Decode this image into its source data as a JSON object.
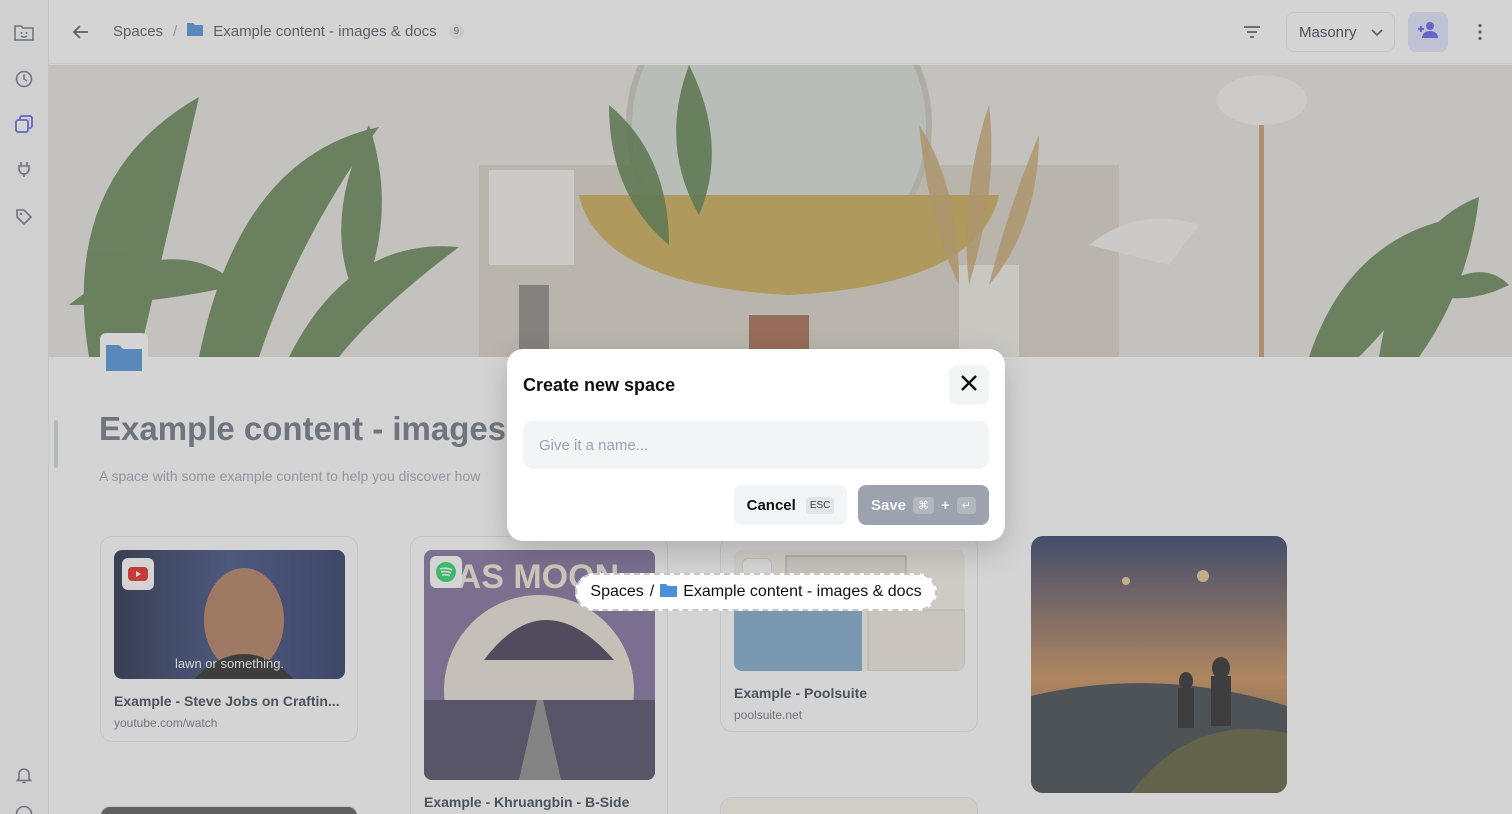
{
  "breadcrumb": {
    "root": "Spaces",
    "separator": "/",
    "space": "Example content - images & docs",
    "count": "9"
  },
  "toolbar": {
    "view_mode": "Masonry"
  },
  "space": {
    "title": "Example content - images & docs",
    "description": "A space with some example content to help you discover how"
  },
  "cards": [
    {
      "title": "Example - Steve Jobs on Craftin...",
      "url": "youtube.com/watch",
      "caption": "lawn or something.",
      "source_icon": "youtube-icon"
    },
    {
      "title": "Example - Khruangbin - B-Side",
      "url": "",
      "caption": "",
      "source_icon": "spotify-icon"
    },
    {
      "title": "Example - Poolsuite",
      "url": "poolsuite.net",
      "caption": "",
      "source_icon": "app-icon"
    },
    {
      "title": "",
      "url": "",
      "caption": "",
      "source_icon": ""
    }
  ],
  "modal": {
    "title": "Create new space",
    "placeholder": "Give it a name...",
    "cancel_label": "Cancel",
    "cancel_key": "ESC",
    "save_label": "Save",
    "save_key_cmd": "⌘",
    "save_key_plus": "+",
    "save_key_enter": "↵"
  },
  "drag_chip": {
    "root": "Spaces",
    "separator": "/",
    "space": "Example content - images & docs"
  },
  "colors": {
    "accent": "#5b5fef",
    "overlay": "rgba(120,120,120,0.32)",
    "save_disabled": "#9ca3af"
  }
}
